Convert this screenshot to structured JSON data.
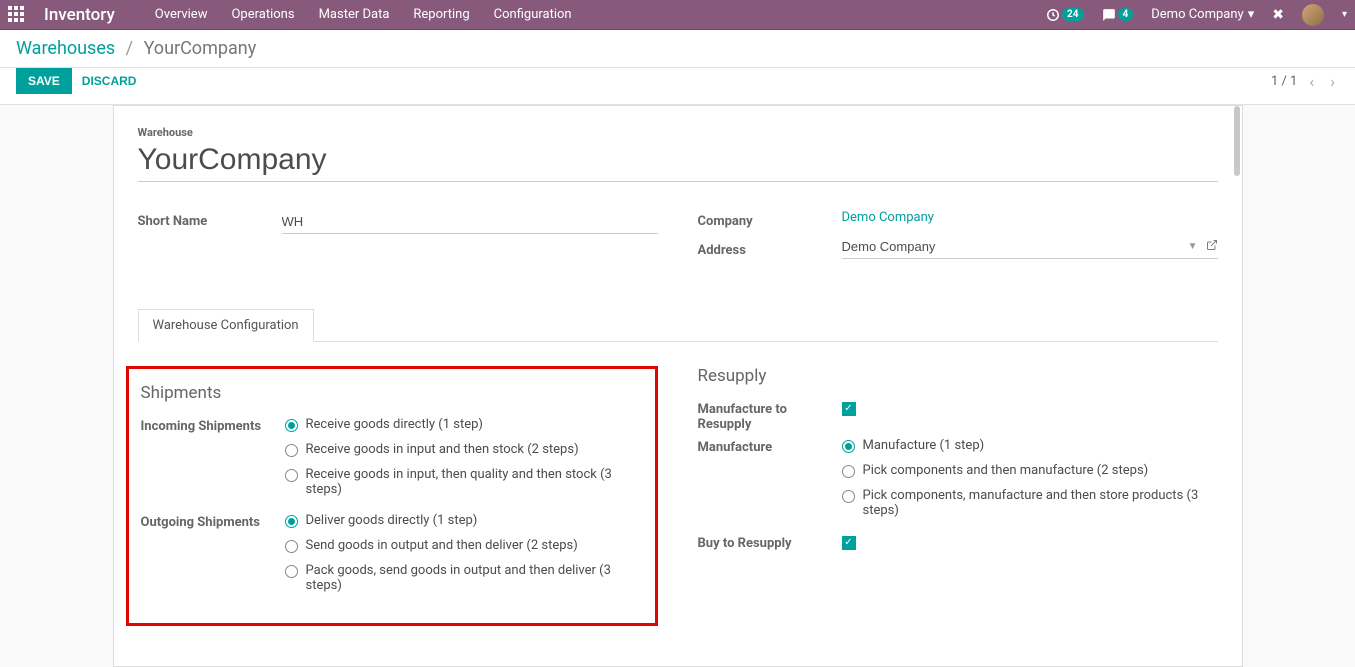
{
  "topbar": {
    "app_title": "Inventory",
    "menu": [
      "Overview",
      "Operations",
      "Master Data",
      "Reporting",
      "Configuration"
    ],
    "clock_badge": "24",
    "chat_badge": "4",
    "company": "Demo Company"
  },
  "breadcrumb": {
    "root": "Warehouses",
    "current": "YourCompany"
  },
  "actions": {
    "save": "SAVE",
    "discard": "DISCARD",
    "pager": "1 / 1"
  },
  "form": {
    "warehouse_label": "Warehouse",
    "name": "YourCompany",
    "shortname_label": "Short Name",
    "shortname": "WH",
    "company_label": "Company",
    "company_value": "Demo Company",
    "address_label": "Address",
    "address_value": "Demo Company"
  },
  "tabs": {
    "config": "Warehouse Configuration"
  },
  "shipments": {
    "title": "Shipments",
    "incoming_label": "Incoming Shipments",
    "incoming_options": [
      "Receive goods directly (1 step)",
      "Receive goods in input and then stock (2 steps)",
      "Receive goods in input, then quality and then stock (3 steps)"
    ],
    "outgoing_label": "Outgoing Shipments",
    "outgoing_options": [
      "Deliver goods directly (1 step)",
      "Send goods in output and then deliver (2 steps)",
      "Pack goods, send goods in output and then deliver (3 steps)"
    ]
  },
  "resupply": {
    "title": "Resupply",
    "mfg_to_resupply_label": "Manufacture to Resupply",
    "manufacture_label": "Manufacture",
    "manufacture_options": [
      "Manufacture (1 step)",
      "Pick components and then manufacture (2 steps)",
      "Pick components, manufacture and then store products (3 steps)"
    ],
    "buy_to_resupply_label": "Buy to Resupply"
  }
}
